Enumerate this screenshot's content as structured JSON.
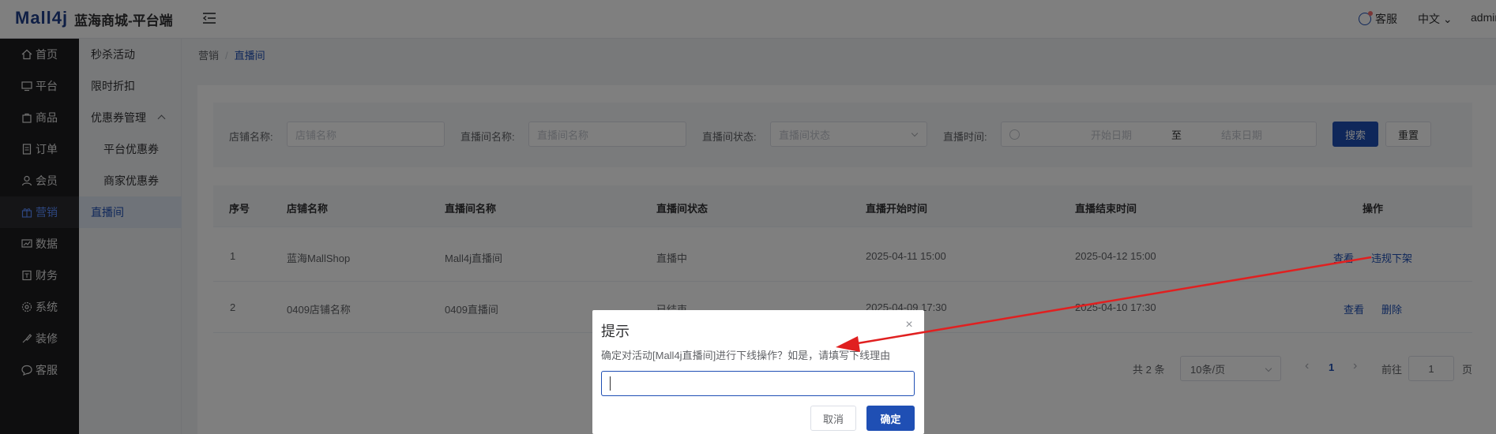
{
  "header": {
    "logo": "Mall4j",
    "site_title": "蓝海商城-平台端",
    "customer_service": "客服",
    "language": "中文",
    "user": "admin"
  },
  "sidebar": {
    "items": [
      {
        "label": "首页",
        "icon": "home-icon"
      },
      {
        "label": "平台",
        "icon": "monitor-icon"
      },
      {
        "label": "商品",
        "icon": "shopping-bag-icon"
      },
      {
        "label": "订单",
        "icon": "document-icon"
      },
      {
        "label": "会员",
        "icon": "user-icon"
      },
      {
        "label": "营销",
        "icon": "gift-icon"
      },
      {
        "label": "数据",
        "icon": "chart-icon"
      },
      {
        "label": "财务",
        "icon": "wallet-icon"
      },
      {
        "label": "系统",
        "icon": "gear-icon"
      },
      {
        "label": "装修",
        "icon": "paint-icon"
      },
      {
        "label": "客服",
        "icon": "chat-icon"
      }
    ],
    "active": "营销"
  },
  "subnav": {
    "items": [
      "秒杀活动",
      "限时折扣",
      "优惠券管理",
      "平台优惠券",
      "商家优惠券",
      "直播间"
    ],
    "active": "直播间"
  },
  "breadcrumb": {
    "parent": "营销",
    "separator": "/",
    "current": "直播间"
  },
  "filters": {
    "store_label": "店铺名称:",
    "store_placeholder": "店铺名称",
    "room_label": "直播间名称:",
    "room_placeholder": "直播间名称",
    "status_label": "直播间状态:",
    "status_placeholder": "直播间状态",
    "time_label": "直播时间:",
    "start_placeholder": "开始日期",
    "range_sep": "至",
    "end_placeholder": "结束日期",
    "search_button": "搜索",
    "reset_button": "重置"
  },
  "table": {
    "headers": [
      "序号",
      "店铺名称",
      "直播间名称",
      "直播间状态",
      "直播开始时间",
      "直播结束时间",
      "操作"
    ],
    "rows": [
      {
        "index": "1",
        "store": "蓝海MallShop",
        "room": "Mall4j直播间",
        "status": "直播中",
        "start": "2025-04-11 15:00",
        "end": "2025-04-12 15:00",
        "actions": [
          "查看",
          "违规下架"
        ]
      },
      {
        "index": "2",
        "store": "0409店铺名称",
        "room": "0409直播间",
        "status": "已结束",
        "start": "2025-04-09 17:30",
        "end": "2025-04-10 17:30",
        "actions": [
          "查看",
          "删除"
        ]
      }
    ]
  },
  "pagination": {
    "total": "共 2 条",
    "page_size": "10条/页",
    "prev": "‹",
    "current_page": "1",
    "next": "›",
    "goto_label": "前往",
    "goto_value": "1",
    "page_unit": "页"
  },
  "dialog": {
    "title": "提示",
    "close": "×",
    "message": "确定对活动[Mall4j直播间]进行下线操作？如是，请填写下线理由",
    "input_value": "",
    "cancel": "取消",
    "confirm": "确定"
  },
  "colors": {
    "primary": "#1f4fb4",
    "sidebar_bg": "#1d1d1f",
    "annotation_arrow": "#e02020"
  }
}
